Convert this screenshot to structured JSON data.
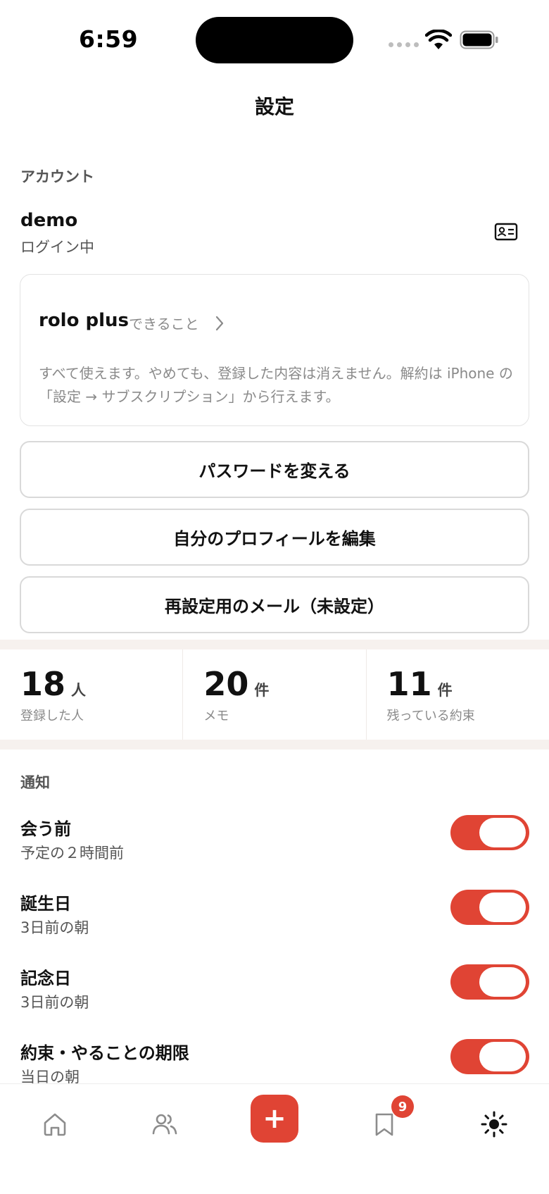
{
  "status_bar": {
    "time": "6:59"
  },
  "header": {
    "title": "設定"
  },
  "account": {
    "section_label": "アカウント",
    "name": "demo",
    "status": "ログイン中"
  },
  "plan": {
    "title": "rolo plus",
    "link_label": "できること",
    "description": "すべて使えます。やめても、登録した内容は消えません。解約は iPhone の「設定 → サブスクリプション」から行えます。"
  },
  "actions": {
    "change_password": "パスワードを変える",
    "edit_profile": "自分のプロフィールを編集",
    "recovery_email": "再設定用のメール（未設定）"
  },
  "stats": [
    {
      "value": "18",
      "unit": "人",
      "label": "登録した人"
    },
    {
      "value": "20",
      "unit": "件",
      "label": "メモ"
    },
    {
      "value": "11",
      "unit": "件",
      "label": "残っている約束"
    }
  ],
  "notifications": {
    "section_label": "通知",
    "items": [
      {
        "title": "会う前",
        "subtitle": "予定の２時間前",
        "enabled": true
      },
      {
        "title": "誕生日",
        "subtitle": "3日前の朝",
        "enabled": true
      },
      {
        "title": "記念日",
        "subtitle": "3日前の朝",
        "enabled": true
      },
      {
        "title": "約束・やることの期限",
        "subtitle": "当日の朝",
        "enabled": true
      }
    ]
  },
  "tab_bar": {
    "tabs": [
      "home-icon",
      "people-icon",
      "add-icon",
      "bookmark-icon",
      "settings-icon"
    ],
    "add_label": "+",
    "bookmark_badge": "9",
    "accent_color": "#e04434"
  }
}
